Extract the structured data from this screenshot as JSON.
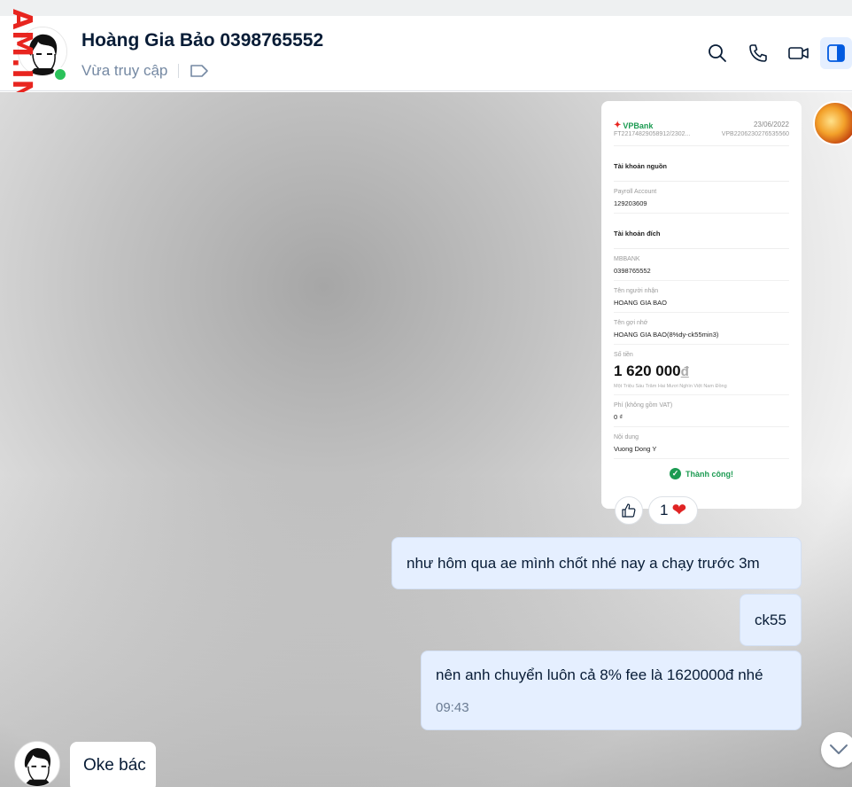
{
  "watermark": "AM.INFO",
  "contact": {
    "name": "Hoàng Gia Bảo 0398765552",
    "status": "Vừa truy cập"
  },
  "header_icons": [
    "search-icon",
    "phone-icon",
    "video-call-icon",
    "sidebar-toggle-icon"
  ],
  "receipt": {
    "bank": "VPBank",
    "date": "23/06/2022",
    "ref_left": "FT22174829058912/2302...",
    "ref_right": "VPB2206230276535560",
    "source_title": "Tài khoản nguồn",
    "source_label": "Payroll Account",
    "source_value": "129203609",
    "dest_title": "Tài khoản đích",
    "dest_bank": "MBBANK",
    "dest_account": "0398765552",
    "recipient_label": "Tên người nhận",
    "recipient_value": "HOANG GIA BAO",
    "alias_label": "Tên gợi nhớ",
    "alias_value": "HOANG GIA BAO(8%dy-ck55min3)",
    "amount_label": "Số tiền",
    "amount_value": "1 620 000",
    "amount_currency": "đ",
    "amount_words": "Một Triệu Sáu Trăm Hai Mươi Nghìn Việt Nam Đồng",
    "fee_label": "Phí (không gồm VAT)",
    "fee_value": "0 ₫",
    "content_label": "Nội dung",
    "content_value": "Vuong Dong Y",
    "success": "Thành công!"
  },
  "reactions": {
    "count": "1",
    "emoji": "❤"
  },
  "messages": [
    {
      "text": "như hôm qua ae mình chốt nhé nay a chạy trước 3m"
    },
    {
      "text": "ck55"
    },
    {
      "text": "nên anh chuyển luôn cả 8% fee là 1620000đ nhé",
      "time": "09:43"
    },
    {
      "text": "Oke bác"
    }
  ]
}
